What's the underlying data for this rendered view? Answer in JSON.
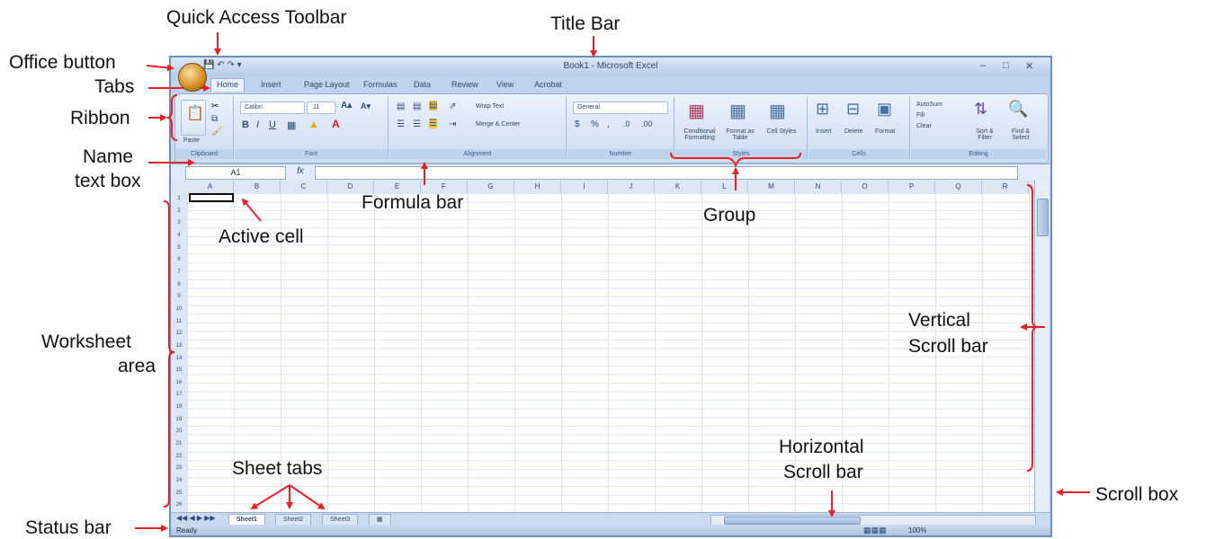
{
  "annotations": {
    "quick_access_toolbar": "Quick Access Toolbar",
    "title_bar": "Title Bar",
    "office_button": "Office button",
    "tabs": "Tabs",
    "ribbon": "Ribbon",
    "name_text_box_1": "Name",
    "name_text_box_2": "text box",
    "formula_bar": "Formula bar",
    "group": "Group",
    "active_cell": "Active cell",
    "vertical_scroll_1": "Vertical",
    "vertical_scroll_2": "Scroll bar",
    "worksheet_area_1": "Worksheet",
    "worksheet_area_2": "area",
    "horizontal_scroll_1": "Horizontal",
    "horizontal_scroll_2": "Scroll bar",
    "sheet_tabs": "Sheet tabs",
    "scroll_box": "Scroll box",
    "status_bar": "Status bar"
  },
  "window": {
    "title": "Book1 - Microsoft Excel",
    "tabs": [
      "Home",
      "Insert",
      "Page Layout",
      "Formulas",
      "Data",
      "Review",
      "View",
      "Acrobat"
    ],
    "ribbon": {
      "clipboard": {
        "paste": "Paste",
        "caption": "Clipboard"
      },
      "font": {
        "name": "Calibri",
        "size": "11",
        "caption": "Font"
      },
      "alignment": {
        "wrap": "Wrap Text",
        "merge": "Merge & Center",
        "caption": "Alignment"
      },
      "number": {
        "format": "General",
        "caption": "Number"
      },
      "styles": {
        "conditional": "Conditional Formatting",
        "format_table": "Format as Table",
        "cell_styles": "Cell Styles",
        "caption": "Styles"
      },
      "cells": {
        "insert": "Insert",
        "delete": "Delete",
        "format": "Format",
        "caption": "Cells"
      },
      "editing": {
        "autosum": "AutoSum",
        "fill": "Fill",
        "clear": "Clear",
        "sort": "Sort & Filter",
        "find": "Find & Select",
        "caption": "Editing"
      }
    },
    "name_box": "A1",
    "columns": [
      "A",
      "B",
      "C",
      "D",
      "E",
      "F",
      "G",
      "H",
      "I",
      "J",
      "K",
      "L",
      "M",
      "N",
      "O",
      "P",
      "Q",
      "R"
    ],
    "rows": [
      "1",
      "2",
      "3",
      "4",
      "5",
      "6",
      "7",
      "8",
      "9",
      "10",
      "11",
      "12",
      "13",
      "14",
      "15",
      "16",
      "17",
      "18",
      "19",
      "20",
      "21",
      "22",
      "23",
      "24",
      "25",
      "26"
    ],
    "sheets": [
      "Sheet1",
      "Sheet2",
      "Sheet3"
    ],
    "status": "Ready",
    "zoom": "100%"
  },
  "colors": {
    "arrow": "#e8202a",
    "window_frame": "#6d8fb8",
    "ribbon": "#dbe7f6"
  }
}
